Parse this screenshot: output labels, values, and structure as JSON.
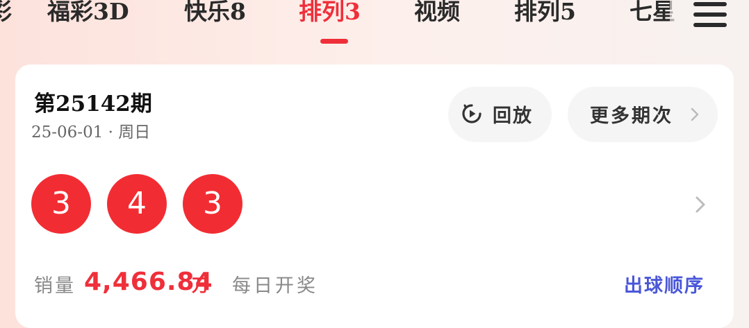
{
  "tabs": [
    {
      "label": "彩"
    },
    {
      "label": "福彩3D"
    },
    {
      "label": "快乐8"
    },
    {
      "label": "排列3",
      "active": true
    },
    {
      "label": "视频"
    },
    {
      "label": "排列5"
    },
    {
      "label": "七星"
    }
  ],
  "menu_icon": "hamburger-menu-icon",
  "draw": {
    "issue": "第25142期",
    "date": "25-06-01 · 周日",
    "replay_label": "回放",
    "more_label": "更多期次",
    "balls": [
      "3",
      "4",
      "3"
    ]
  },
  "sales": {
    "label": "销量",
    "value": "4,466.84",
    "unit": "万",
    "schedule": "每日开奖",
    "order_link": "出球顺序"
  },
  "colors": {
    "accent": "#ef2f3a",
    "ball": "#f12d33",
    "link": "#4a57d8"
  }
}
